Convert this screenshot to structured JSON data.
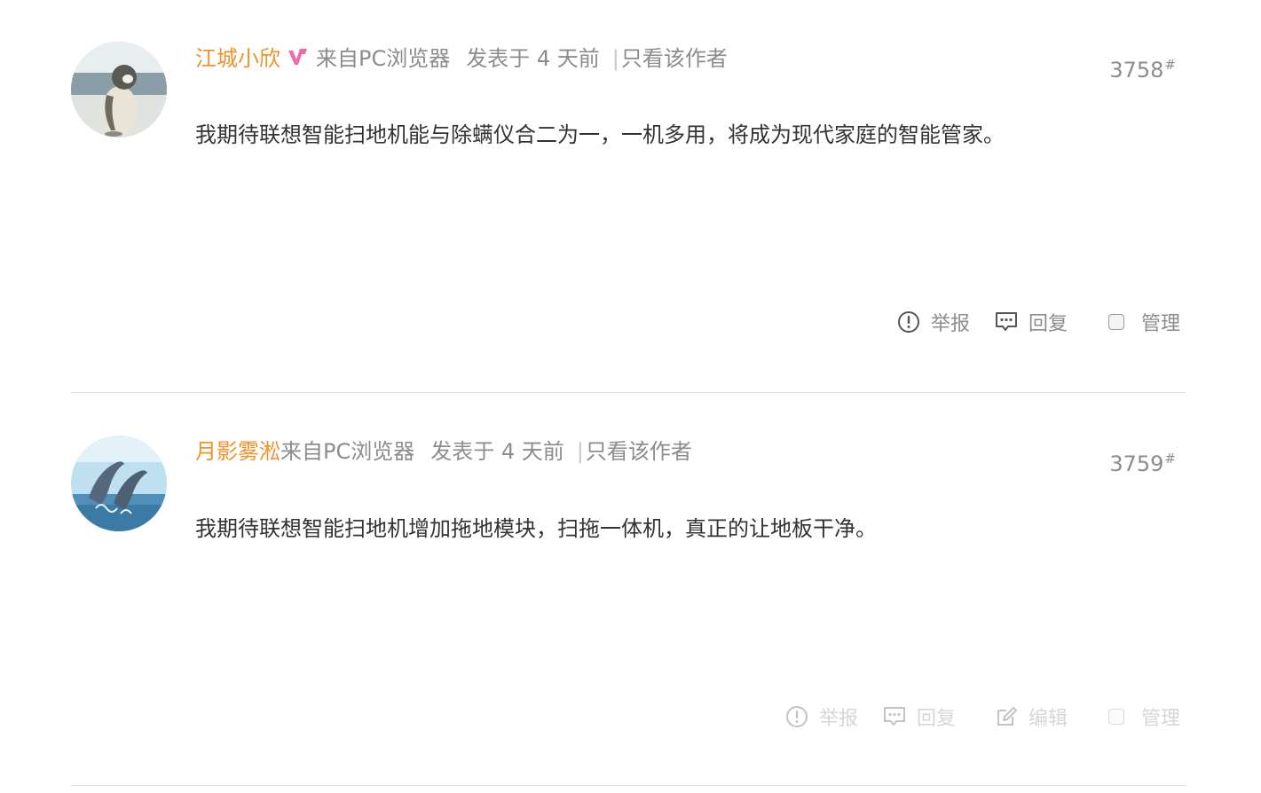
{
  "posts": [
    {
      "username": "江城小欣",
      "has_vip_badge": true,
      "source": "来自PC浏览器",
      "post_time": "发表于 4 天前",
      "separator": "|",
      "author_only": "只看该作者",
      "floor_number": "3758",
      "floor_mark": "#",
      "content": "我期待联想智能扫地机能与除螨仪合二为一，一机多用，将成为现代家庭的智能管家。",
      "avatar_icon": "penguin-avatar",
      "actions": {
        "report": "举报",
        "reply": "回复",
        "manage": "管理"
      }
    },
    {
      "username": "月影雾淞",
      "has_vip_badge": false,
      "source": "来自PC浏览器",
      "post_time": "发表于 4 天前",
      "separator": "|",
      "author_only": "只看该作者",
      "floor_number": "3759",
      "floor_mark": "#",
      "content": "我期待联想智能扫地机增加拖地模块，扫拖一体机，真正的让地板干净。",
      "avatar_icon": "dolphins-avatar",
      "actions": {
        "report": "举报",
        "reply": "回复",
        "edit": "编辑",
        "manage": "管理"
      }
    }
  ],
  "colors": {
    "username": "#f0922b",
    "meta_text": "#8c8c8c",
    "content_text": "#333333",
    "divider": "#e3e3e3",
    "vip_badge": "#f06aa8"
  }
}
